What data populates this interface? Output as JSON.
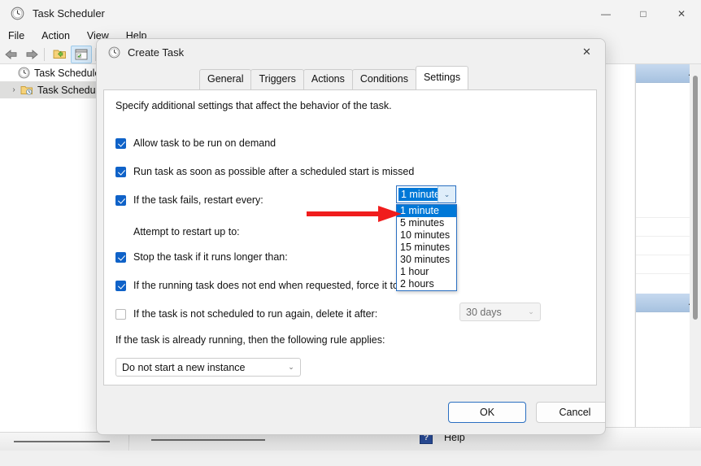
{
  "main_window": {
    "title": "Task Scheduler",
    "title_icon": "clock-icon",
    "window_controls": {
      "minimize": "—",
      "maximize": "□",
      "close": "✕"
    },
    "menu": [
      {
        "label": "File"
      },
      {
        "label": "Action"
      },
      {
        "label": "View"
      },
      {
        "label": "Help"
      }
    ],
    "toolbar": [
      {
        "name": "back-arrow-icon",
        "label": ""
      },
      {
        "name": "forward-arrow-icon",
        "label": ""
      },
      {
        "name": "open-folder-icon",
        "label": ""
      },
      {
        "name": "show-hide-console-tree-icon",
        "label": ""
      }
    ],
    "tree": [
      {
        "label": "Task Scheduler (L",
        "icon": "clock-icon",
        "expander": "",
        "selected": false
      },
      {
        "label": "Task Schedule",
        "icon": "folder-clock-icon",
        "expander": "›",
        "selected": true
      }
    ],
    "right_pane": {
      "header_chevron": "▲",
      "row_arrow": "▶"
    },
    "status_help": {
      "icon": "help-icon",
      "icon_glyph": "?",
      "label": "Help"
    }
  },
  "dialog": {
    "title": "Create Task",
    "title_icon": "clock-icon",
    "close_glyph": "✕",
    "tabs": [
      {
        "label": "General",
        "active": false
      },
      {
        "label": "Triggers",
        "active": false
      },
      {
        "label": "Actions",
        "active": false
      },
      {
        "label": "Conditions",
        "active": false
      },
      {
        "label": "Settings",
        "active": true
      }
    ],
    "settings": {
      "intro": "Specify additional settings that affect the behavior of the task.",
      "options": [
        {
          "label": "Allow task to be run on demand",
          "checked": true
        },
        {
          "label": "Run task as soon as possible after a scheduled start is missed",
          "checked": true
        },
        {
          "label": "If the task fails, restart every:",
          "checked": true
        },
        {
          "label": "Stop the task if it runs longer than:",
          "checked": true
        },
        {
          "label": "If the running task does not end when requested, force it to stop",
          "checked": true
        },
        {
          "label": "If the task is not scheduled to run again, delete it after:",
          "checked": false
        }
      ],
      "attempt_restart_label": "Attempt to restart up to:",
      "restart_every_combo": {
        "name": "restart-every-dropdown",
        "value": "1 minute",
        "expanded": true,
        "options": [
          "1 minute",
          "5 minutes",
          "10 minutes",
          "15 minutes",
          "30 minutes",
          "1 hour",
          "2 hours"
        ],
        "selected_index": 0
      },
      "delete_after_combo": {
        "name": "delete-after-dropdown",
        "value": "30 days",
        "enabled": false
      },
      "already_running_label": "If the task is already running, then the following rule applies:",
      "instance_rule_combo": {
        "name": "instance-rule-dropdown",
        "value": "Do not start a new instance"
      },
      "chevron_glyph": "⌄"
    },
    "buttons": [
      {
        "label": "OK",
        "name": "ok-button",
        "default": true
      },
      {
        "label": "Cancel",
        "name": "cancel-button",
        "default": false
      }
    ]
  },
  "annotation": {
    "arrow_color": "#f01d1d",
    "name": "red-pointer-arrow",
    "points_to": "restart-every-dropdown"
  },
  "colors": {
    "accent_blue": "#0078d7",
    "checkbox_blue": "#0f62c8",
    "dialog_bg": "#f0f0f0",
    "panel_white": "#ffffff",
    "right_pane_header": "#a7c2e0"
  }
}
